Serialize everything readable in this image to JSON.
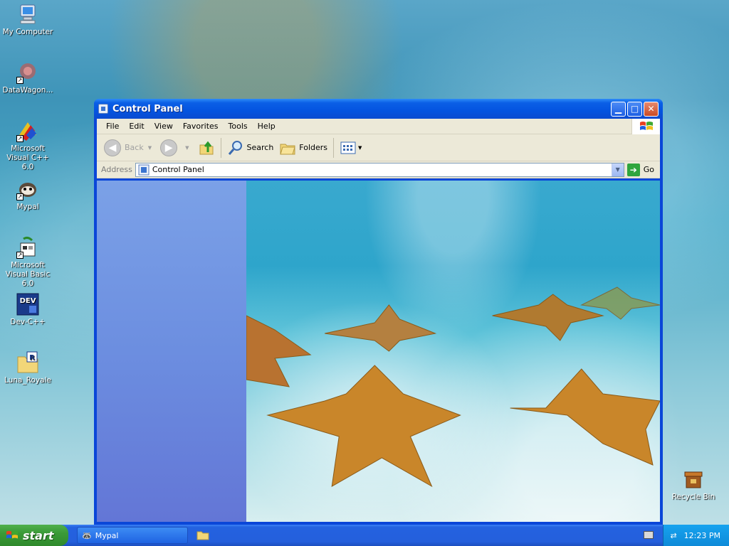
{
  "desktop": {
    "icons": [
      {
        "label": "My Computer",
        "icon": "my-computer-icon"
      },
      {
        "label": "DataWagon...",
        "icon": "datawagon-icon"
      },
      {
        "label": "Microsoft Visual C++ 6.0",
        "icon": "visual-cpp-icon"
      },
      {
        "label": "Mypal",
        "icon": "mypal-icon"
      },
      {
        "label": "Microsoft Visual Basic 6.0",
        "icon": "visual-basic-icon"
      },
      {
        "label": "Dev-C++",
        "icon": "dev-cpp-icon"
      },
      {
        "label": "Luna_Royale",
        "icon": "luna-royale-icon"
      },
      {
        "label": "Recycle Bin",
        "icon": "recycle-bin-icon"
      }
    ]
  },
  "window": {
    "title": "Control Panel",
    "menu": [
      "File",
      "Edit",
      "View",
      "Favorites",
      "Tools",
      "Help"
    ],
    "toolbar": {
      "back": "Back",
      "search": "Search",
      "folders": "Folders"
    },
    "address": {
      "label": "Address",
      "value": "Control Panel",
      "go": "Go"
    }
  },
  "taskbar": {
    "start": "start",
    "tasks": [
      {
        "label": "Mypal",
        "icon": "mypal-icon"
      }
    ],
    "clock": "12:23 PM"
  },
  "colors": {
    "title_blue": "#0454e0",
    "start_green": "#3b9a37",
    "tray_blue": "#0e8ad8",
    "task_pane": "#6c8ee0"
  }
}
